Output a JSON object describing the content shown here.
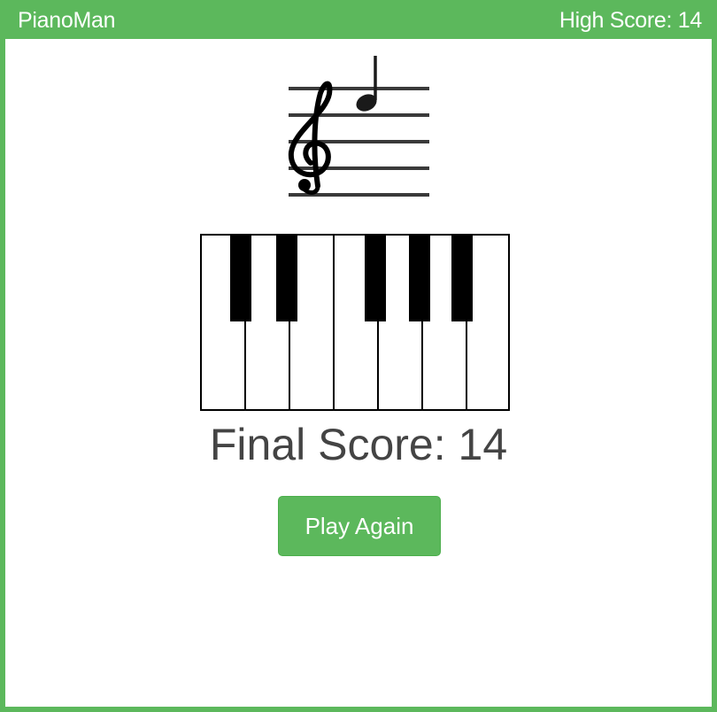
{
  "header": {
    "title": "PianoMan",
    "high_score_label": "High Score: 14",
    "bg_color": "#5cb85c"
  },
  "game": {
    "clef_icon": "treble-clef-icon",
    "note_icon": "quarter-note-icon",
    "piano": {
      "white_keys": 7,
      "black_key_icon": "piano-black-key",
      "white_key_icon": "piano-white-key"
    },
    "final_score_label": "Final Score: 14",
    "final_score_value": 14,
    "high_score_value": 14
  },
  "actions": {
    "play_again_label": "Play Again",
    "button_color": "#5cb85c"
  }
}
